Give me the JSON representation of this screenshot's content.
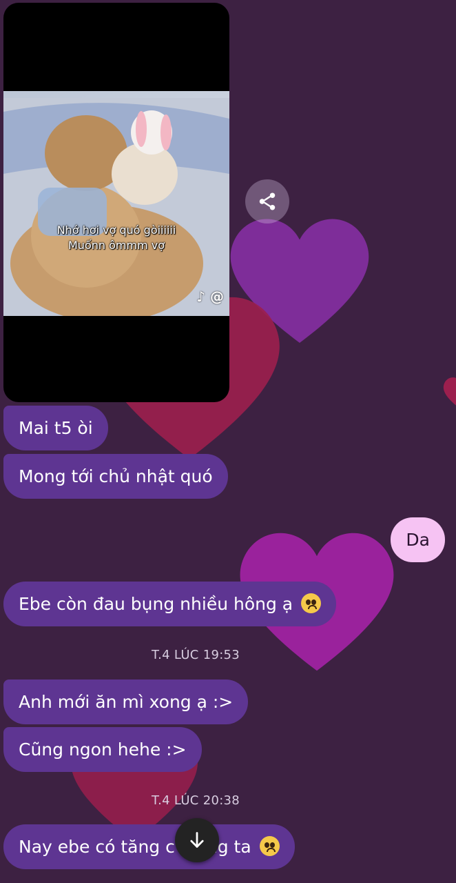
{
  "video": {
    "caption_line1": "Nhớ hơi vợ quó gòiiiiii",
    "caption_line2": "Muốnn ômmm vợ",
    "watermark": "@"
  },
  "messages": {
    "m1": "Mai t5 òi",
    "m2": "Mong tới chủ nhật quó",
    "m3_outgoing": "Da",
    "m4": "Ebe còn đau bụng nhiều hông ạ",
    "ts1": "T.4 LÚC 19:53",
    "m5": "Anh mới ăn mì xong ạ :>",
    "m6": "Cũng ngon hehe :>",
    "ts2": "T.4 LÚC 20:38",
    "m7_part1": "Nay ebe có tăng c",
    "m7_part2": "ng ta"
  },
  "icons": {
    "share": "share-icon",
    "scroll_down": "arrow-down-icon",
    "emoji": "pleading-face-emoji-icon"
  },
  "colors": {
    "background": "#3d2142",
    "incoming_bubble": "#5e3592",
    "outgoing_bubble": "#f6c3f3"
  }
}
